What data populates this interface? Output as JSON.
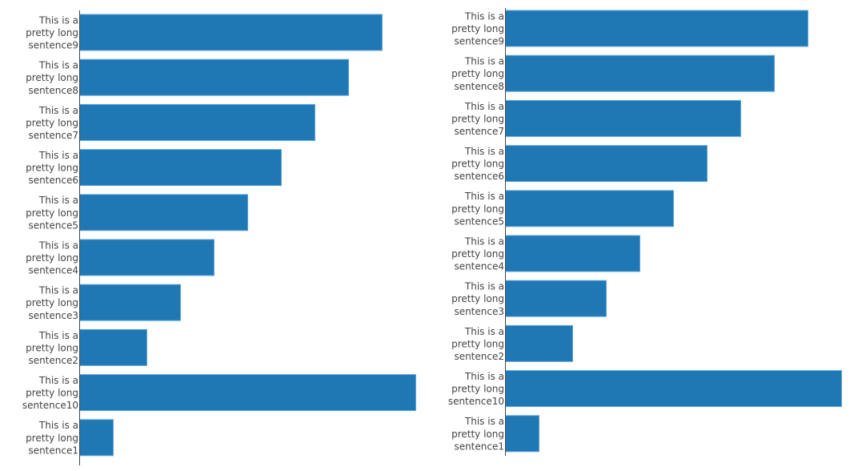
{
  "chart_data": [
    {
      "type": "bar",
      "orientation": "horizontal",
      "title": "",
      "xlabel": "",
      "ylabel": "",
      "categories": [
        "This is a pretty long sentence9",
        "This is a pretty long sentence8",
        "This is a pretty long sentence7",
        "This is a pretty long sentence6",
        "This is a pretty long sentence5",
        "This is a pretty long sentence4",
        "This is a pretty long sentence3",
        "This is a pretty long sentence2",
        "This is a pretty long sentence10",
        "This is a pretty long sentence1"
      ],
      "category_lines": [
        [
          "This is a",
          "pretty long",
          "sentence9"
        ],
        [
          "This is a",
          "pretty long",
          "sentence8"
        ],
        [
          "This is a",
          "pretty long",
          "sentence7"
        ],
        [
          "This is a",
          "pretty long",
          "sentence6"
        ],
        [
          "This is a",
          "pretty long",
          "sentence5"
        ],
        [
          "This is a",
          "pretty long",
          "sentence4"
        ],
        [
          "This is a",
          "pretty long",
          "sentence3"
        ],
        [
          "This is a",
          "pretty long",
          "sentence2"
        ],
        [
          "This is a",
          "pretty long",
          "sentence10"
        ],
        [
          "This is a",
          "pretty long",
          "sentence1"
        ]
      ],
      "values": [
        9,
        8,
        7,
        6,
        5,
        4,
        3,
        2,
        10,
        1
      ],
      "xlim": [
        0,
        10
      ],
      "grid": false,
      "bar_color": "#1f77b4",
      "bar_edge_color": "#5fa8dc",
      "axis_color": "#444444"
    },
    {
      "type": "bar",
      "orientation": "horizontal",
      "title": "",
      "xlabel": "",
      "ylabel": "",
      "categories": [
        "This is a pretty long sentence9",
        "This is a pretty long sentence8",
        "This is a pretty long sentence7",
        "This is a pretty long sentence6",
        "This is a pretty long sentence5",
        "This is a pretty long sentence4",
        "This is a pretty long sentence3",
        "This is a pretty long sentence2",
        "This is a pretty long sentence10",
        "This is a pretty long sentence1"
      ],
      "category_lines": [
        [
          "This is a",
          "pretty long",
          "sentence9"
        ],
        [
          "This is a",
          "pretty long",
          "sentence8"
        ],
        [
          "This is a",
          "pretty long",
          "sentence7"
        ],
        [
          "This is a",
          "pretty long",
          "sentence6"
        ],
        [
          "This is a",
          "pretty long",
          "sentence5"
        ],
        [
          "This is a",
          "pretty long",
          "sentence4"
        ],
        [
          "This is a",
          "pretty long",
          "sentence3"
        ],
        [
          "This is a",
          "pretty long",
          "sentence2"
        ],
        [
          "This is a",
          "pretty long",
          "sentence10"
        ],
        [
          "This is a",
          "pretty long",
          "sentence1"
        ]
      ],
      "values": [
        9,
        8,
        7,
        6,
        5,
        4,
        3,
        2,
        10,
        1
      ],
      "xlim": [
        0,
        10
      ],
      "grid": false,
      "bar_color": "#1f77b4",
      "bar_edge_color": "#5fa8dc",
      "axis_color": "#444444"
    }
  ]
}
